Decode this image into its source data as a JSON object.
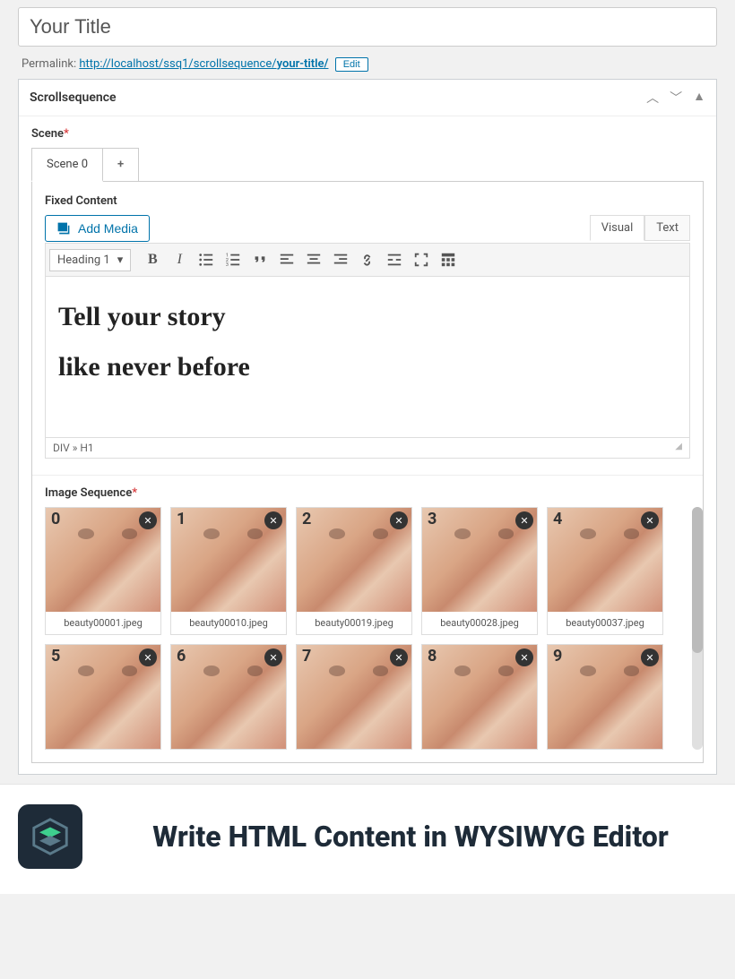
{
  "title": {
    "value": "Your Title"
  },
  "permalink": {
    "label": "Permalink:",
    "base": "http://localhost/ssq1/scrollsequence/",
    "slug": "your-title/",
    "edit": "Edit"
  },
  "metabox": {
    "title": "Scrollsequence"
  },
  "scene": {
    "label": "Scene",
    "tabs": [
      {
        "label": "Scene 0"
      }
    ]
  },
  "fixedContent": {
    "label": "Fixed Content",
    "addMedia": "Add Media",
    "editorTabs": {
      "visual": "Visual",
      "text": "Text"
    },
    "formatSelect": "Heading 1",
    "content": {
      "line1": "Tell your story",
      "line2": "like never before"
    },
    "breadcrumb": "DIV » H1"
  },
  "imageSequence": {
    "label": "Image Sequence",
    "items": [
      {
        "index": "0",
        "caption": "beauty00001.jpeg"
      },
      {
        "index": "1",
        "caption": "beauty00010.jpeg"
      },
      {
        "index": "2",
        "caption": "beauty00019.jpeg"
      },
      {
        "index": "3",
        "caption": "beauty00028.jpeg"
      },
      {
        "index": "4",
        "caption": "beauty00037.jpeg"
      },
      {
        "index": "5",
        "caption": ""
      },
      {
        "index": "6",
        "caption": ""
      },
      {
        "index": "7",
        "caption": ""
      },
      {
        "index": "8",
        "caption": ""
      },
      {
        "index": "9",
        "caption": ""
      }
    ]
  },
  "footer": {
    "title": "Write HTML Content in WYSIWYG Editor"
  }
}
